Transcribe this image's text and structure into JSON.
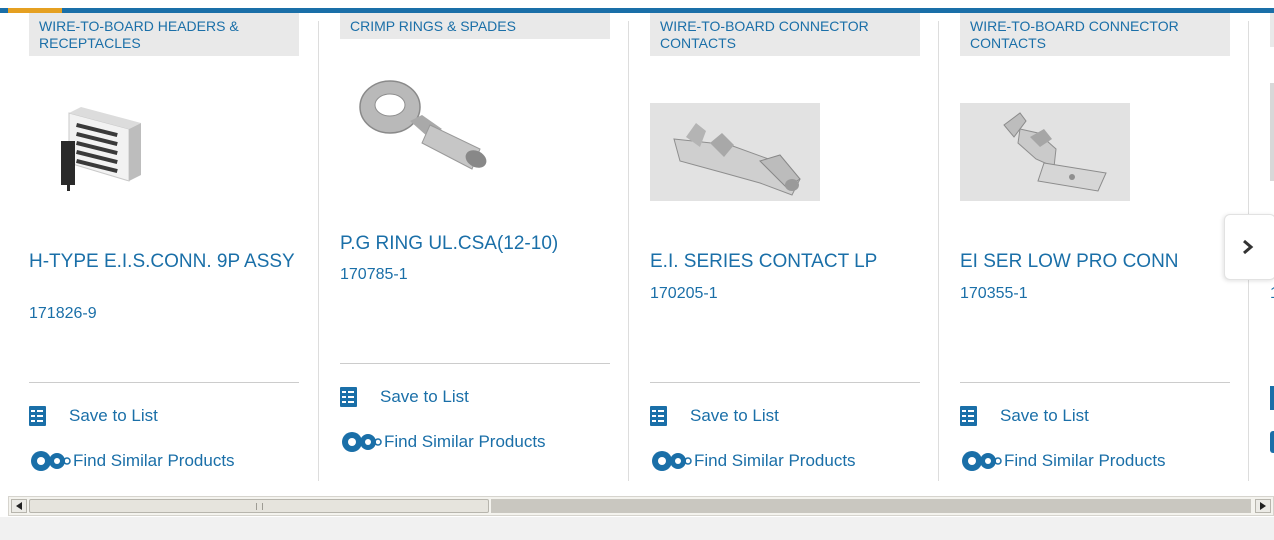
{
  "products": [
    {
      "category": "WIRE-TO-BOARD HEADERS & RECEPTACLES",
      "name": "H-TYPE E.I.S.CONN. 9P ASSY",
      "part_number": "171826-9",
      "save_label": "Save to List",
      "similar_label": "Find Similar Products",
      "image": "header-connector-image"
    },
    {
      "category": "CRIMP RINGS & SPADES",
      "name": "P.G RING UL.CSA(12-10)",
      "part_number": "170785-1",
      "save_label": "Save to List",
      "similar_label": "Find Similar Products",
      "image": "ring-terminal-image"
    },
    {
      "category": "WIRE-TO-BOARD CONNECTOR CONTACTS",
      "name": "E.I. SERIES CONTACT LP",
      "part_number": "170205-1",
      "save_label": "Save to List",
      "similar_label": "Find Similar Products",
      "image": "contact-image"
    },
    {
      "category": "WIRE-TO-BOARD CONNECTOR CONTACTS",
      "name": "EI SER LOW PRO CONN",
      "part_number": "170355-1",
      "save_label": "Save to List",
      "similar_label": "Find Similar Products",
      "image": "contact-image"
    }
  ],
  "partial_card": {
    "part_number_peek": "1"
  },
  "colors": {
    "accent_blue": "#1a6fa8",
    "accent_orange": "#e5a021",
    "category_bg": "#e9e9e9"
  }
}
